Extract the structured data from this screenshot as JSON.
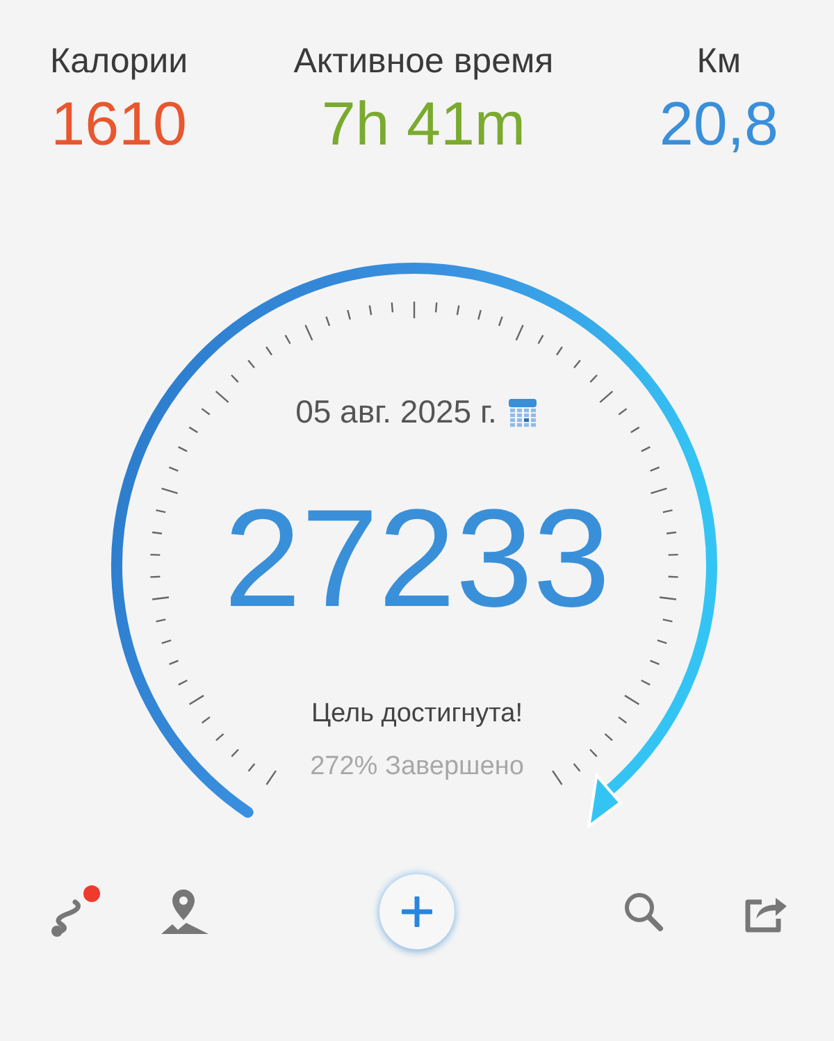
{
  "stats": [
    {
      "label": "Калории",
      "value": "1610",
      "color": "#e8572f"
    },
    {
      "label": "Активное время",
      "value": "7h 41m",
      "color": "#7aaa2e"
    },
    {
      "label": "Км",
      "value": "20,8",
      "color": "#3a8fd9"
    }
  ],
  "gauge": {
    "date": "05 авг. 2025 г.",
    "steps": "27233",
    "status": "Цель достигнута!",
    "progress": "272% Завершено"
  },
  "toolbar": {
    "route_badge": true
  }
}
